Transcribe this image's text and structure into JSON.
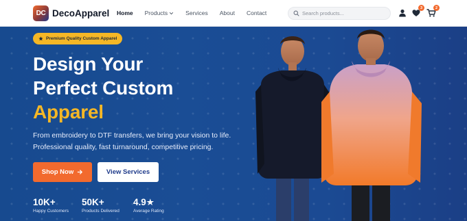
{
  "brand": {
    "logo_initials": "DC",
    "name": "DecoApparel"
  },
  "nav": {
    "links": [
      {
        "label": "Home",
        "active": true
      },
      {
        "label": "Products",
        "has_dropdown": true
      },
      {
        "label": "Services"
      },
      {
        "label": "About"
      },
      {
        "label": "Contact"
      }
    ]
  },
  "search": {
    "placeholder": "Search products...",
    "icon": "search-icon"
  },
  "header_icons": {
    "account": {
      "icon": "user-icon"
    },
    "wishlist": {
      "icon": "heart-icon",
      "count": "3"
    },
    "cart": {
      "icon": "cart-icon",
      "count": "2"
    }
  },
  "hero": {
    "badge": {
      "icon": "star-icon",
      "text": "Premium Quality Custom Apparel"
    },
    "headline": {
      "line1": "Design Your",
      "line2": "Perfect Custom",
      "line3": "Apparel"
    },
    "subtitle": "From embroidery to DTF transfers, we bring your vision to life. Professional quality, fast turnaround, competitive pricing.",
    "primary_button": {
      "label": "Shop Now",
      "icon": "arrow-right-icon"
    },
    "secondary_button": {
      "label": "View Services"
    },
    "stats": [
      {
        "value": "10K+",
        "label": "Happy Customers"
      },
      {
        "value": "50K+",
        "label": "Products Delivered"
      },
      {
        "value": "4.9★",
        "label": "Average Rating"
      }
    ]
  },
  "colors": {
    "accent_orange": "#f26a2e",
    "accent_yellow": "#f5b726",
    "hero_blue": "#1a4d95",
    "text_dark": "#111827"
  }
}
